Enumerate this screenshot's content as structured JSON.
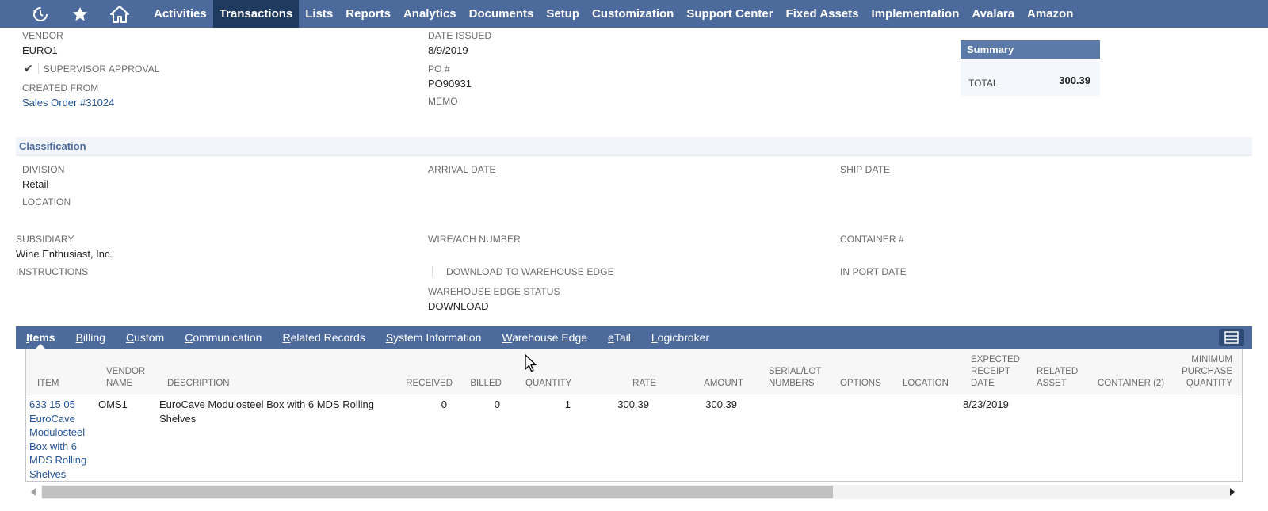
{
  "topnav": {
    "icons": [
      "recent-icon",
      "star-icon",
      "home-icon"
    ],
    "items": [
      {
        "label": "Activities"
      },
      {
        "label": "Transactions",
        "active": true
      },
      {
        "label": "Lists"
      },
      {
        "label": "Reports"
      },
      {
        "label": "Analytics"
      },
      {
        "label": "Documents"
      },
      {
        "label": "Setup"
      },
      {
        "label": "Customization"
      },
      {
        "label": "Support Center"
      },
      {
        "label": "Fixed Assets"
      },
      {
        "label": "Implementation"
      },
      {
        "label": "Avalara"
      },
      {
        "label": "Amazon"
      }
    ],
    "colors": {
      "bar": "#4d6a9c",
      "active": "#1e3a5f"
    }
  },
  "header_fields": {
    "vendor": {
      "label": "VENDOR",
      "value": "EURO1"
    },
    "supervisor_approval": {
      "label": "SUPERVISOR APPROVAL",
      "checked": true
    },
    "created_from": {
      "label": "CREATED FROM",
      "value": "Sales Order #31024"
    },
    "date_issued": {
      "label": "DATE ISSUED",
      "value": "8/9/2019"
    },
    "po": {
      "label": "PO #",
      "value": "PO90931"
    },
    "memo": {
      "label": "MEMO",
      "value": ""
    }
  },
  "summary": {
    "title": "Summary",
    "total_label": "TOTAL",
    "total_value": "300.39"
  },
  "classification": {
    "title": "Classification",
    "division": {
      "label": "DIVISION",
      "value": "Retail"
    },
    "location": {
      "label": "LOCATION",
      "value": ""
    },
    "arrival_date": {
      "label": "ARRIVAL DATE",
      "value": ""
    },
    "ship_date": {
      "label": "SHIP DATE",
      "value": ""
    },
    "subsidiary": {
      "label": "SUBSIDIARY",
      "value": "Wine Enthusiast, Inc."
    },
    "instructions": {
      "label": "INSTRUCTIONS",
      "value": ""
    },
    "wire_ach": {
      "label": "WIRE/ACH NUMBER",
      "value": ""
    },
    "download_wh_edge": {
      "label": "DOWNLOAD TO WAREHOUSE EDGE",
      "checked": false
    },
    "wh_edge_status": {
      "label": "WAREHOUSE EDGE STATUS",
      "value": "DOWNLOAD"
    },
    "container": {
      "label": "CONTAINER #",
      "value": ""
    },
    "in_port_date": {
      "label": "IN PORT DATE",
      "value": ""
    }
  },
  "subtabs": [
    {
      "first": "I",
      "rest": "tems",
      "active": true
    },
    {
      "first": "B",
      "rest": "illing"
    },
    {
      "first": "C",
      "rest": "ustom"
    },
    {
      "first": "C",
      "pre": "",
      "rest": "ommunication"
    },
    {
      "first": "R",
      "rest": "elated Records"
    },
    {
      "first": "S",
      "rest": "ystem Information"
    },
    {
      "first": "W",
      "rest": "arehouse Edge"
    },
    {
      "first": "e",
      "rest": "Tail"
    },
    {
      "first": "L",
      "rest": "ogicbroker"
    }
  ],
  "items_table": {
    "headers": {
      "item": "ITEM",
      "vendor_name": "VENDOR NAME",
      "description": "DESCRIPTION",
      "received": "RECEIVED",
      "billed": "BILLED",
      "quantity": "QUANTITY",
      "rate": "RATE",
      "amount": "AMOUNT",
      "serial_lot": "SERIAL/LOT NUMBERS",
      "options": "OPTIONS",
      "location": "LOCATION",
      "expected_receipt": "EXPECTED RECEIPT DATE",
      "related_asset": "RELATED ASSET",
      "container": "CONTAINER (2)",
      "min_purchase_qty": "MINIMUM PURCHASE QUANTITY"
    },
    "row": {
      "item": "633 15 05 EuroCave Modulosteel Box with 6 MDS Rolling Shelves",
      "vendor_name": "OMS1",
      "description": "EuroCave Modulosteel Box with 6 MDS Rolling Shelves",
      "received": "0",
      "billed": "0",
      "quantity": "1",
      "rate": "300.39",
      "amount": "300.39",
      "expected_receipt": "8/23/2019"
    }
  }
}
